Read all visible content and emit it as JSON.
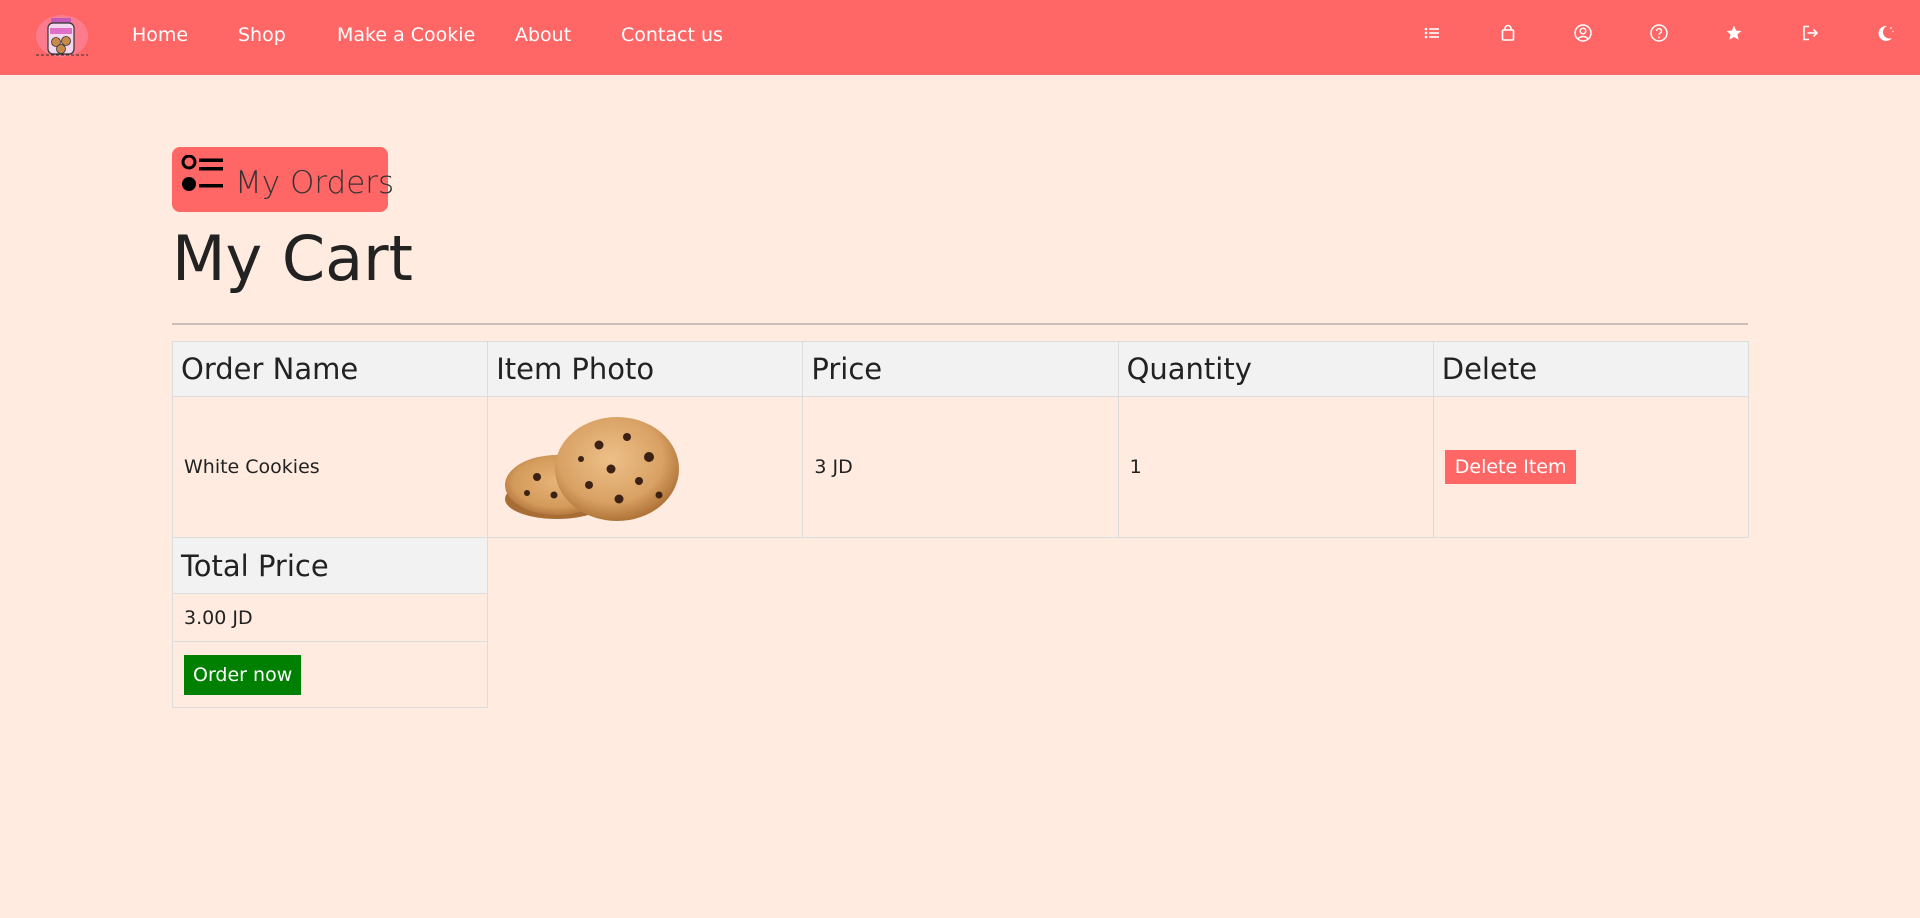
{
  "nav": {
    "logo_name": "cookie-jar-logo",
    "links": [
      {
        "label": "Home"
      },
      {
        "label": "Shop"
      },
      {
        "label": "Make a Cookie"
      },
      {
        "label": "About"
      },
      {
        "label": "Contact us"
      }
    ],
    "icons": [
      "list-icon",
      "shopping-bag-icon",
      "user-circle-icon",
      "help-icon",
      "star-icon",
      "logout-icon",
      "dark-mode-icon"
    ],
    "background_color": "#ff6666"
  },
  "orders_button": {
    "label": "My Orders",
    "icon": "list-icon"
  },
  "page": {
    "title": "My Cart",
    "background_color": "#ffebdf"
  },
  "cart_table": {
    "headers": [
      "Order Name",
      "Item Photo",
      "Price",
      "Quantity",
      "Delete"
    ],
    "rows": [
      {
        "name": "White Cookies",
        "photo": "cookie-photo",
        "price": "3 JD",
        "quantity": "1",
        "delete_label": "Delete Item"
      }
    ]
  },
  "total": {
    "header": "Total Price",
    "value": "3.00 JD",
    "order_label": "Order now",
    "order_color": "#008000"
  }
}
